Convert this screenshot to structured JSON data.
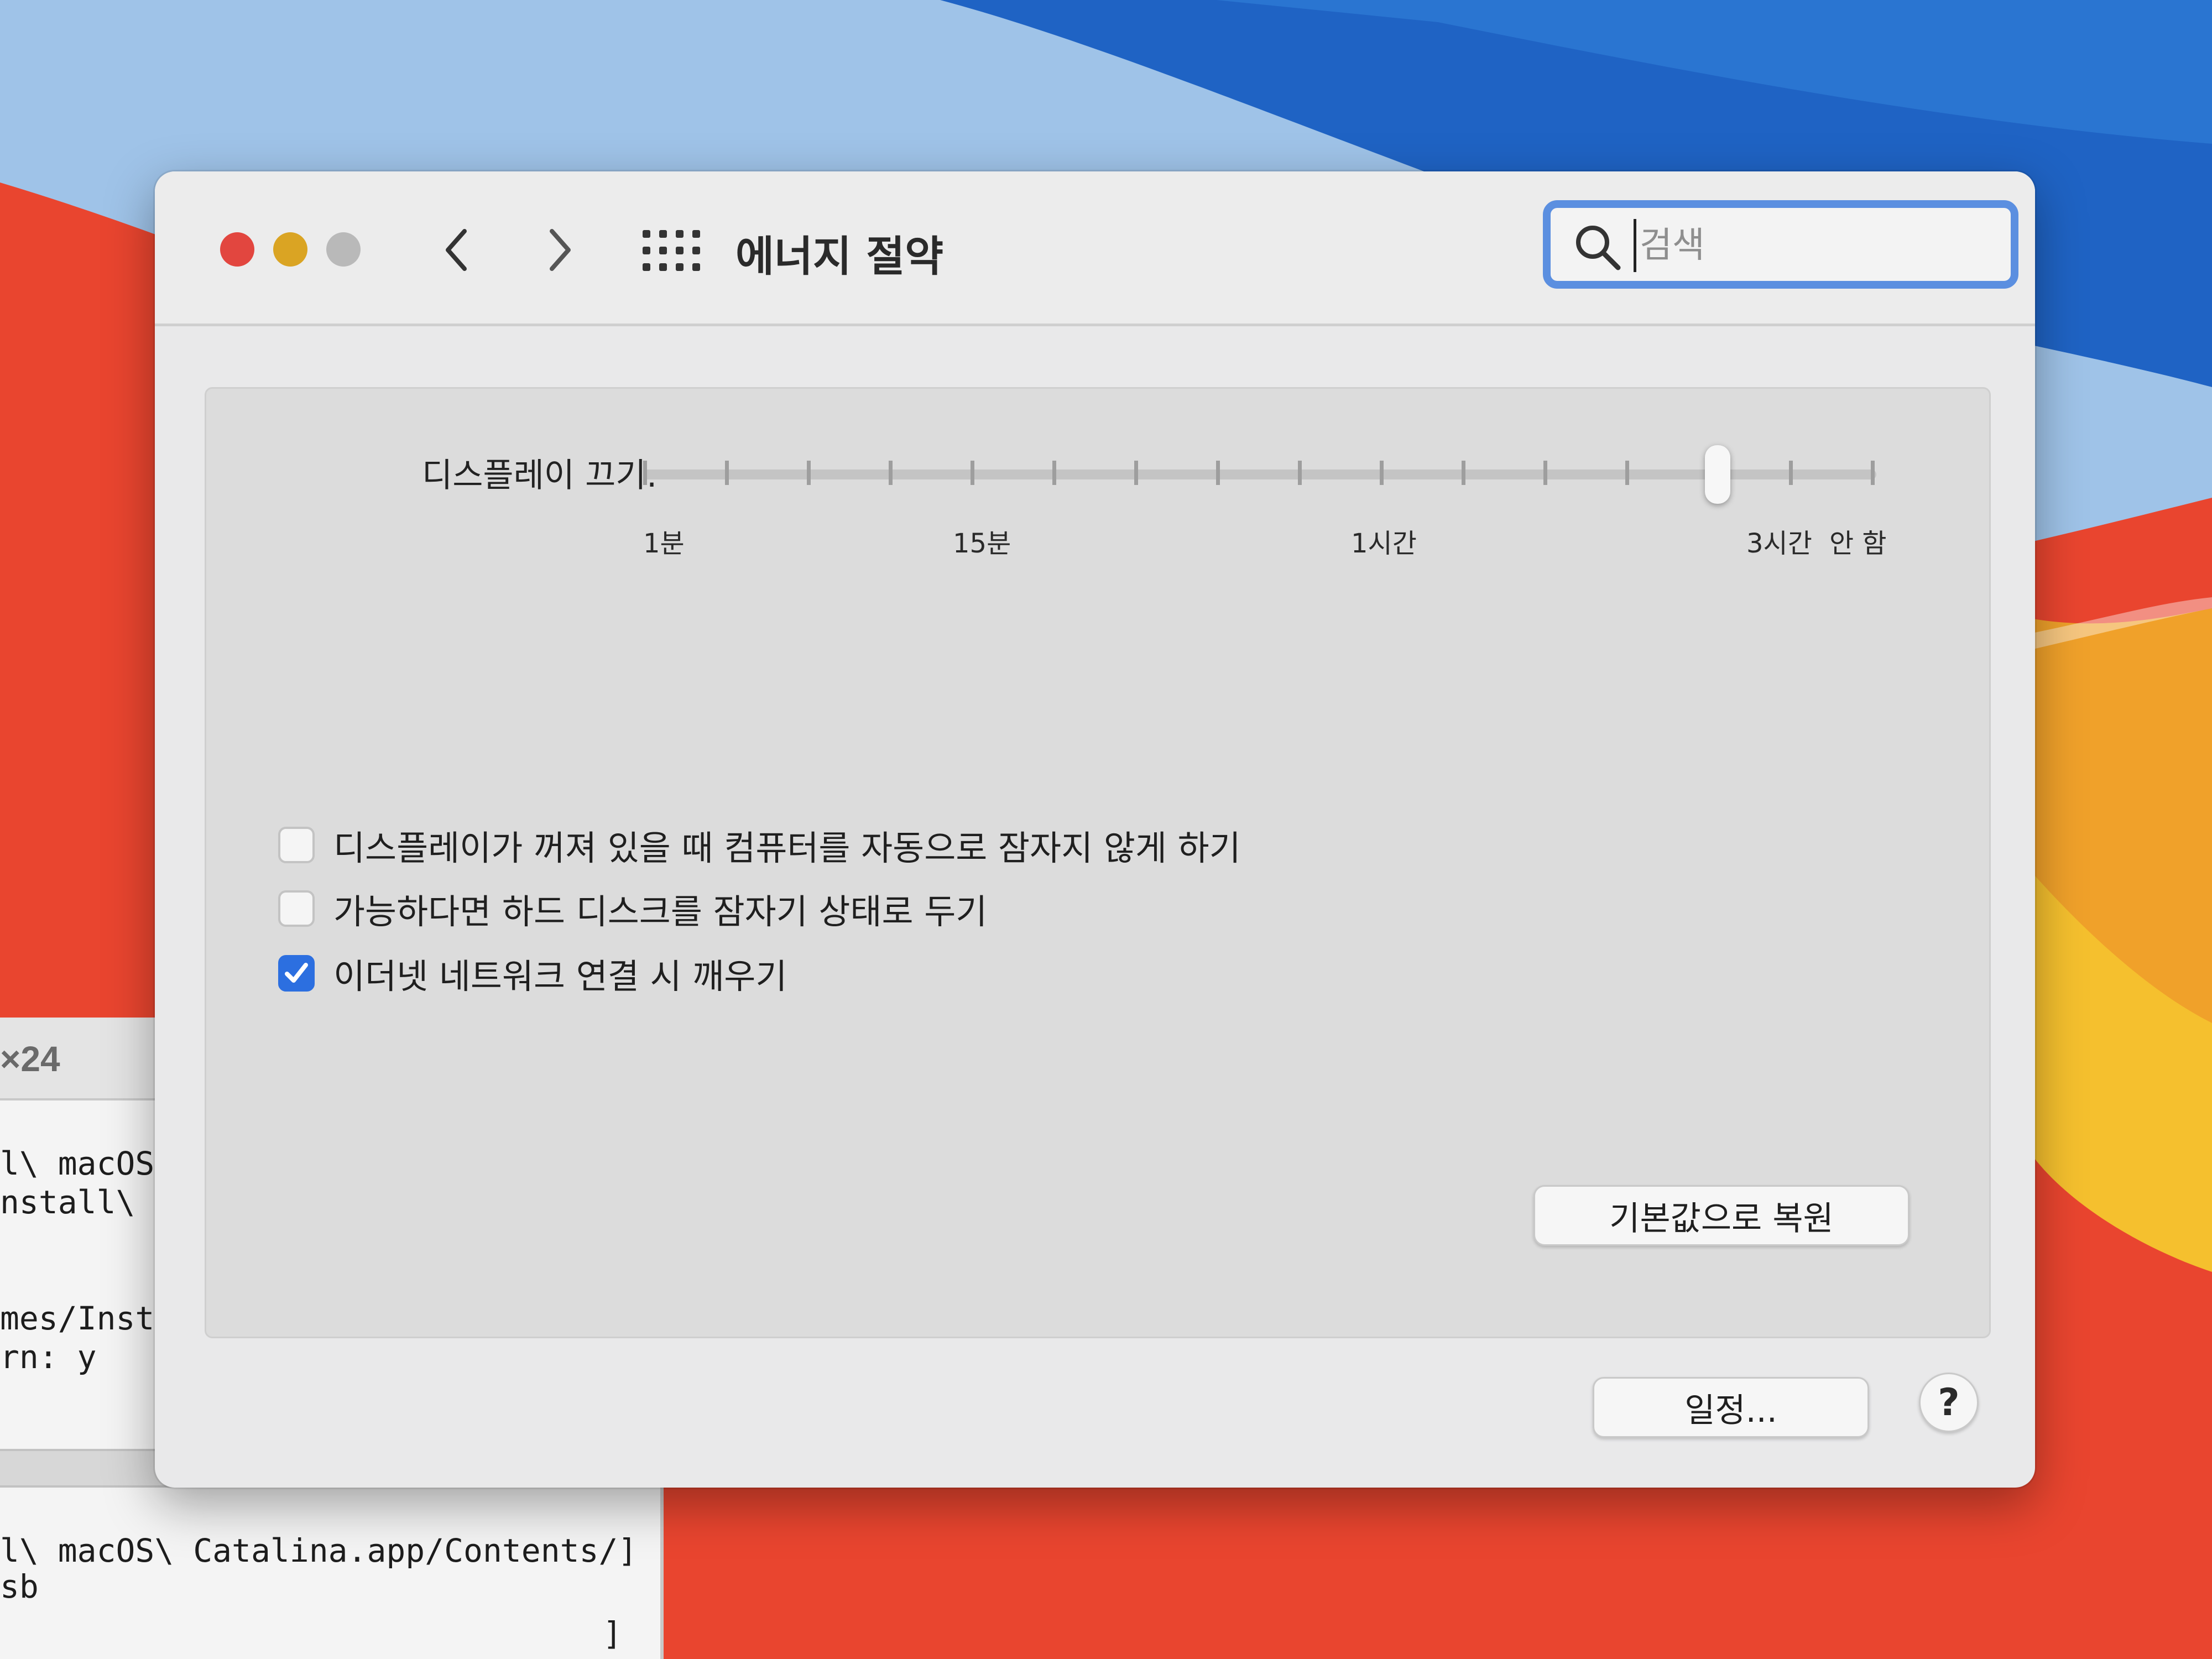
{
  "window": {
    "title": "에너지 절약",
    "traffic_lights": {
      "close_color": "#e2463f",
      "minimize_color": "#daa423",
      "zoom_color": "#b9b9b9"
    },
    "icons": {
      "back": "chevron-left-icon",
      "forward": "chevron-right-icon",
      "show_all": "grid-icon"
    }
  },
  "search": {
    "placeholder": "검색",
    "value": ""
  },
  "display_sleep": {
    "label": "디스플레이 끄기:",
    "tick_labels": [
      "1분",
      "15분",
      "1시간",
      "3시간",
      "안 함"
    ],
    "selected": "3시간"
  },
  "options": [
    {
      "label": "디스플레이가 꺼져 있을 때 컴퓨터를 자동으로 잠자지 않게 하기",
      "checked": false
    },
    {
      "label": "가능하다면 하드 디스크를 잠자기 상태로 두기",
      "checked": false
    },
    {
      "label": "이더넷 네트워크 연결 시 깨우기",
      "checked": true
    }
  ],
  "buttons": {
    "restore_defaults": "기본값으로 복원",
    "schedule": "일정...",
    "help": "?"
  },
  "terminal": {
    "title": "×24",
    "lines": [
      "l\\ macOS",
      "nstall\\ m",
      "mes/Inst",
      "rn: y",
      "l\\ macOS\\ Catalina.app/Contents/]",
      "sb",
      "]"
    ]
  },
  "colors": {
    "accent": "#2c6fe0",
    "search_focus": "#5b8fe0"
  }
}
